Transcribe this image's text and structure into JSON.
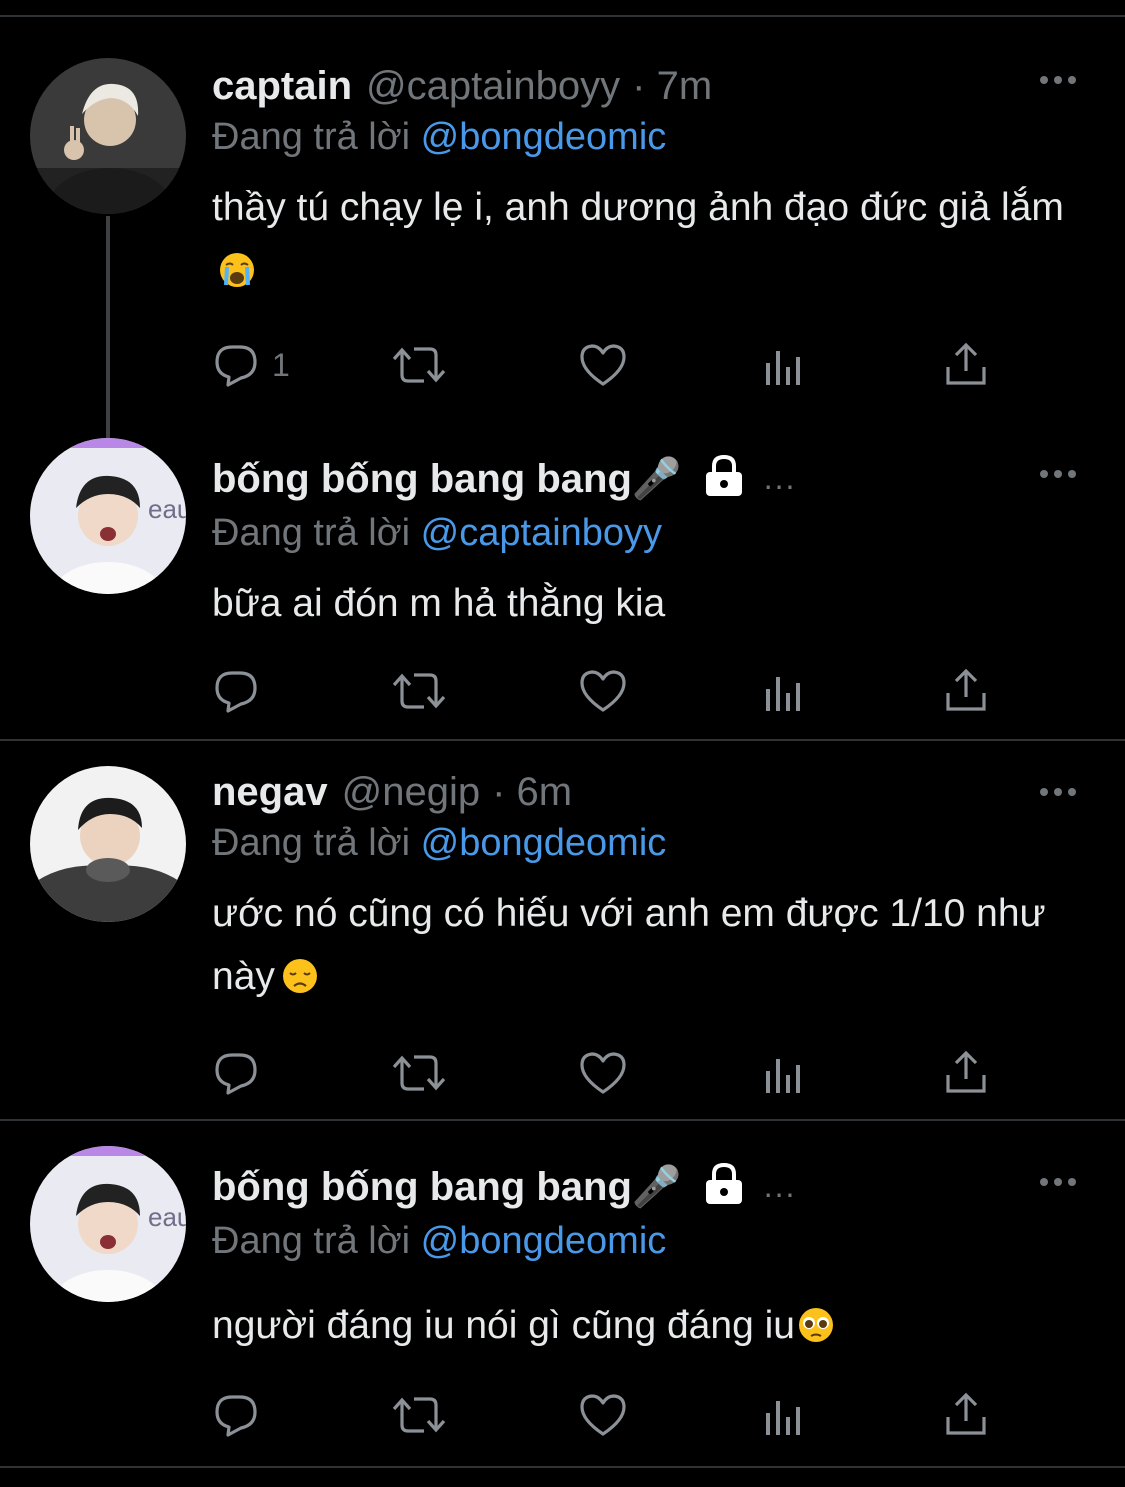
{
  "colors": {
    "background": "#000000",
    "text": "#e7e9ea",
    "muted": "#71767b",
    "mention": "#4a99e9",
    "divider": "#2f3336"
  },
  "reply_prefix": "Đang trả lời",
  "tweets": [
    {
      "name": "captain",
      "handle": "@captainboyy",
      "time": "· 7m",
      "reply_to": "@bongdeomic",
      "text": "thầy tú chạy lẹ i, anh dương ảnh đạo đức giả lắm",
      "emoji": "loudly-crying-face",
      "reply_count": "1"
    },
    {
      "name": "bống bống bang bang🎤",
      "protected": true,
      "ellipsis": "...",
      "reply_to": "@captainboyy",
      "text": "bữa ai đón m hả thằng kia",
      "reply_count": ""
    },
    {
      "name": "negav",
      "handle": "@negip",
      "time": "· 6m",
      "reply_to": "@bongdeomic",
      "text": "ước nó cũng có hiếu với anh em được 1/10 như này",
      "emoji": "disappointed-face",
      "reply_count": ""
    },
    {
      "name": "bống bống bang bang🎤",
      "protected": true,
      "ellipsis": "...",
      "reply_to": "@bongdeomic",
      "text": "người đáng iu nói gì cũng đáng iu",
      "emoji": "pleading-face",
      "reply_count": ""
    }
  ]
}
